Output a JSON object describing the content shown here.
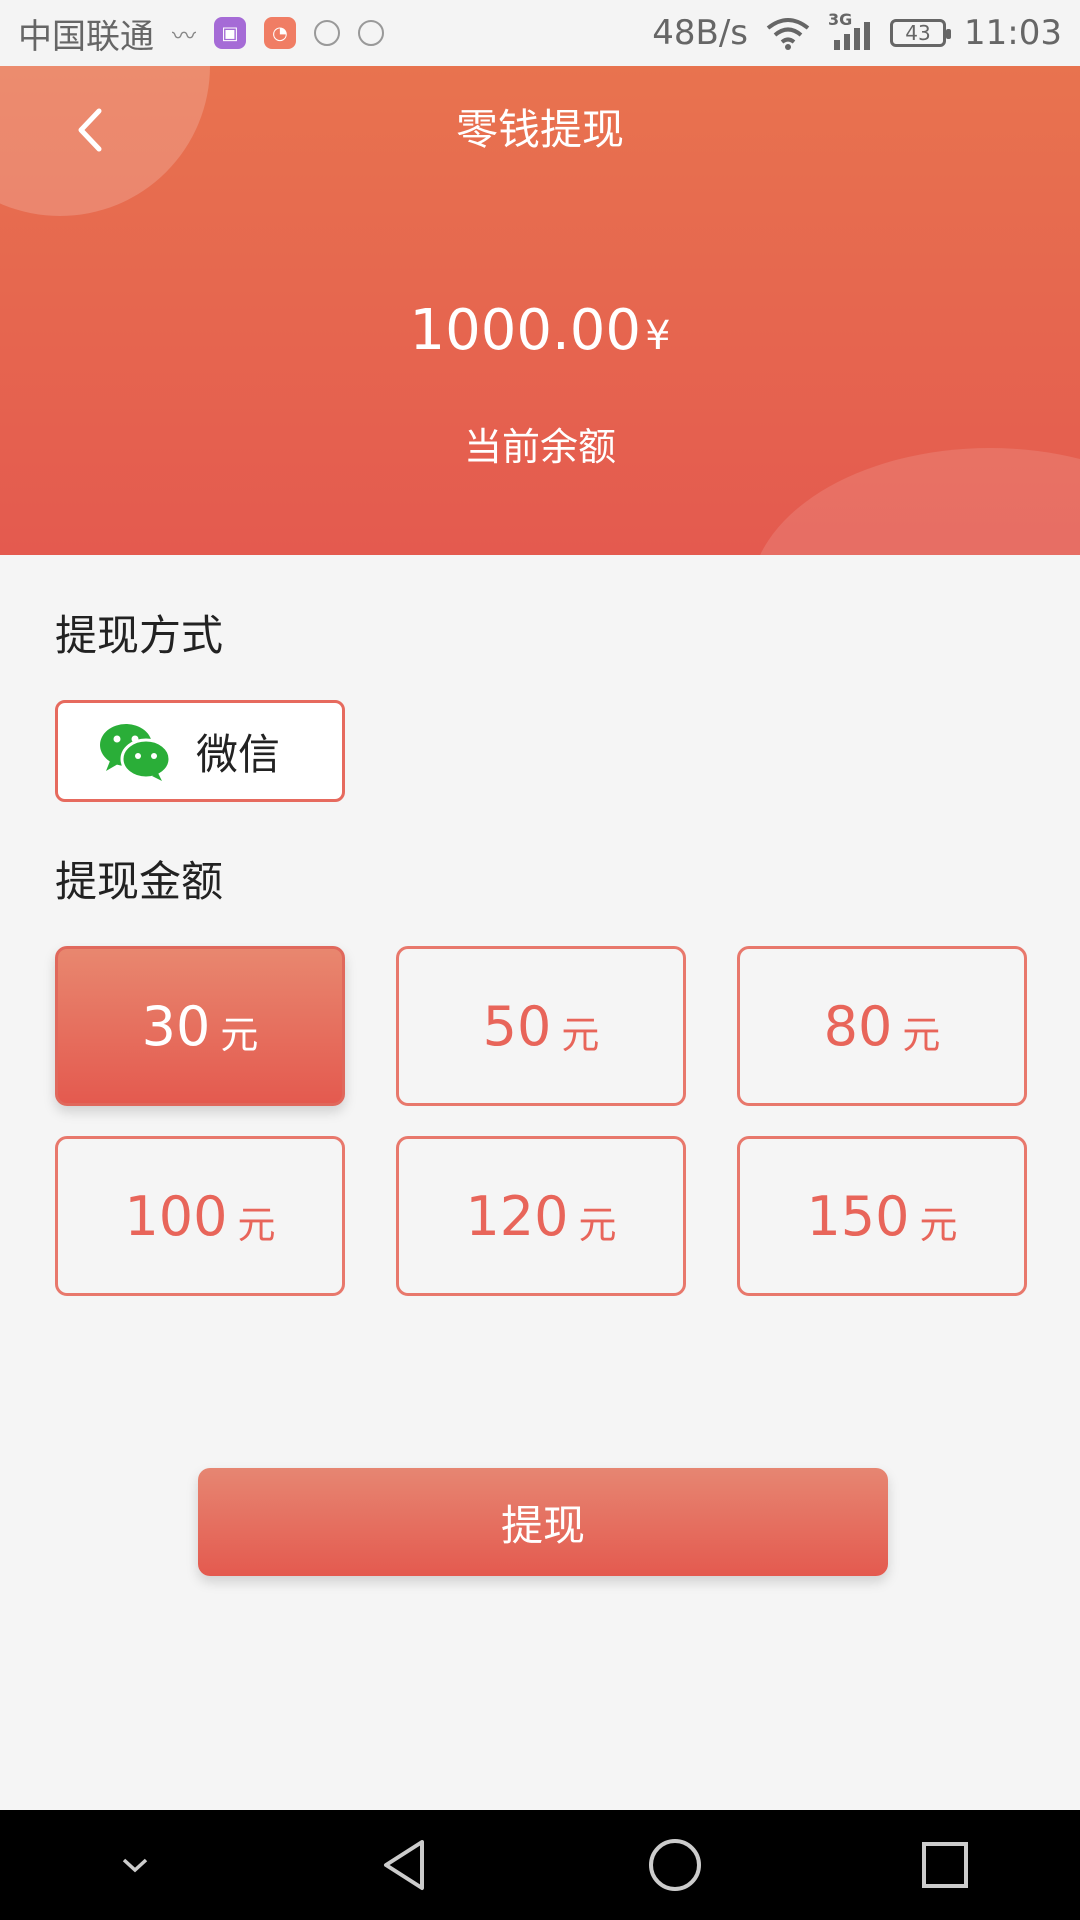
{
  "status_bar": {
    "carrier": "中国联通",
    "net_speed": "48B/s",
    "network_type": "3G",
    "battery": "43",
    "time": "11:03"
  },
  "header": {
    "title": "零钱提现",
    "balance": "1000.00",
    "currency_symbol": "¥",
    "balance_label": "当前余额"
  },
  "method_section": {
    "title": "提现方式",
    "method_label": "微信",
    "method_icon": "wechat-icon"
  },
  "amount_section": {
    "title": "提现金额",
    "unit": "元",
    "options": [
      {
        "value": "30",
        "selected": true
      },
      {
        "value": "50",
        "selected": false
      },
      {
        "value": "80",
        "selected": false
      },
      {
        "value": "100",
        "selected": false
      },
      {
        "value": "120",
        "selected": false
      },
      {
        "value": "150",
        "selected": false
      }
    ]
  },
  "submit_label": "提现",
  "colors": {
    "accent": "#e45a4f",
    "accent_light": "#e8876f",
    "wechat_green": "#2aae38"
  }
}
